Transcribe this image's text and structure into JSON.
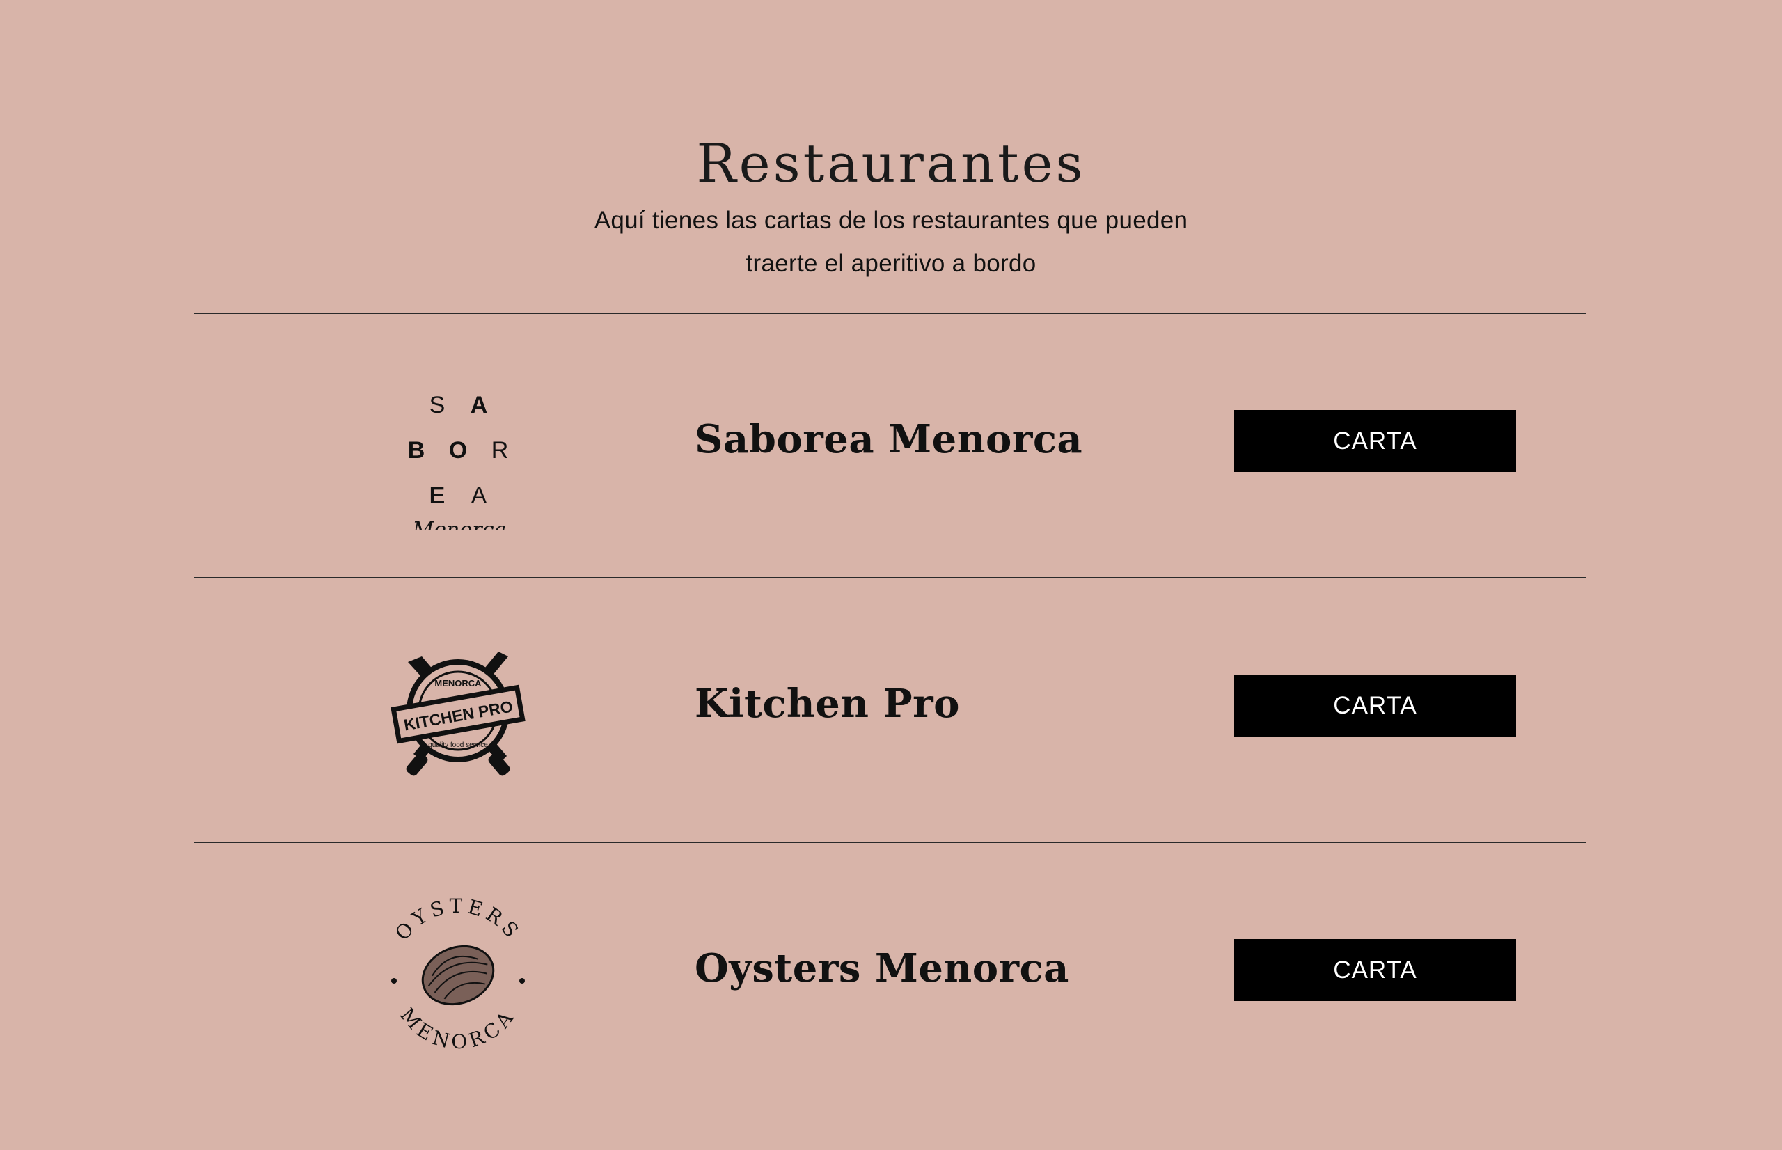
{
  "header": {
    "title": "Restaurantes",
    "subtitle_line1": "Aquí tienes las cartas de los restaurantes que pueden",
    "subtitle_line2": "traerte el aperitivo a bordo"
  },
  "restaurants": [
    {
      "name": "Saborea Menorca",
      "button_label": "CARTA",
      "logo": {
        "icon": "saborea-logo",
        "letters": [
          "S",
          "A",
          "B",
          "O",
          "R",
          "E",
          "A"
        ],
        "script": "Menorca"
      }
    },
    {
      "name": "Kitchen Pro",
      "button_label": "CARTA",
      "logo": {
        "icon": "kitchen-pro-logo",
        "top_text": "MENORCA",
        "banner_text": "KITCHEN PRO",
        "bottom_text": "quality food service"
      }
    },
    {
      "name": "Oysters Menorca",
      "button_label": "CARTA",
      "logo": {
        "icon": "oysters-logo",
        "top_text": "OYSTERS",
        "bottom_text": "MENORCA"
      }
    }
  ],
  "colors": {
    "background": "#d8b4a9",
    "button": "#000000",
    "button_text": "#ffffff",
    "rule": "#2a2a2a"
  }
}
